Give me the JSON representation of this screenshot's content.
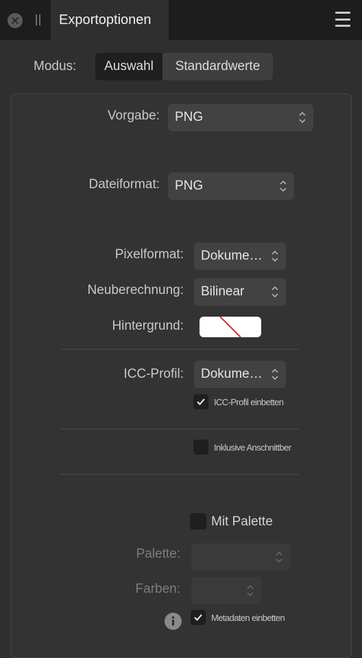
{
  "header": {
    "tab_title": "Exportoptionen"
  },
  "mode": {
    "label": "Modus:",
    "options": [
      "Auswahl",
      "Standardwerte"
    ],
    "selected": "Auswahl"
  },
  "fields": {
    "preset": {
      "label": "Vorgabe:",
      "value": "PNG"
    },
    "file_format": {
      "label": "Dateiformat:",
      "value": "PNG"
    },
    "pixel_format": {
      "label": "Pixelformat:",
      "value": "Dokume…"
    },
    "resampling": {
      "label": "Neuberechnung:",
      "value": "Bilinear"
    },
    "background": {
      "label": "Hintergrund:",
      "value_color": "transparent"
    },
    "icc_profile": {
      "label": "ICC-Profil:",
      "value": "Dokume…"
    },
    "palette": {
      "label": "Palette:",
      "value": ""
    },
    "colors": {
      "label": "Farben:",
      "value": ""
    }
  },
  "checkboxes": {
    "embed_icc": {
      "label": "ICC-Profil einbetten",
      "checked": true
    },
    "include_bleed": {
      "label": "Inklusive Anschnittber",
      "checked": false
    },
    "with_palette": {
      "label": "Mit Palette",
      "checked": false
    },
    "embed_metadata": {
      "label": "Metadaten einbetten",
      "checked": true
    }
  },
  "icons": [
    "close-icon",
    "grip-icon",
    "hamburger-menu-icon",
    "chevron-updown-icon",
    "checkmark-icon",
    "info-icon"
  ],
  "colors": {
    "header_bg": "#1d1d1d",
    "panel_bg": "#2f2f2f",
    "control_bg": "#424242",
    "swatch_slash": "#d0302a"
  }
}
